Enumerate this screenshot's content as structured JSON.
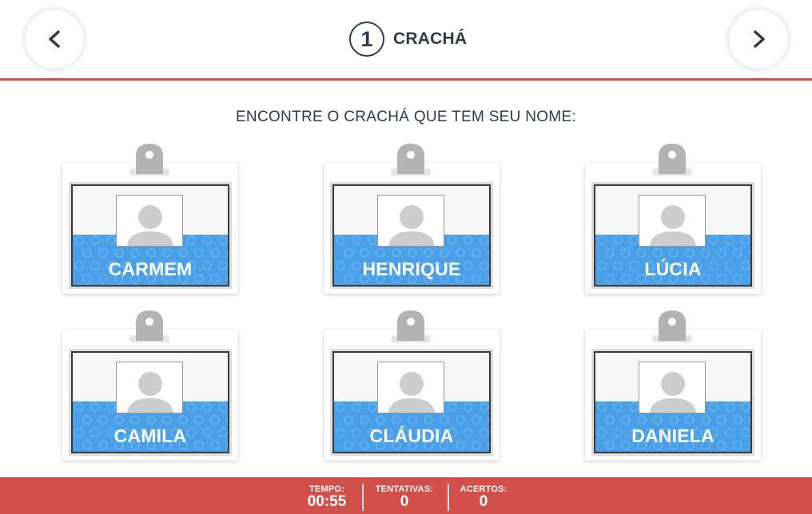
{
  "header": {
    "step_number": "1",
    "title": "CRACHÁ",
    "prev_icon": "chevron-left-icon",
    "next_icon": "chevron-right-icon"
  },
  "instruction": "ENCONTRE O CRACHÁ QUE TEM SEU NOME:",
  "badges": [
    {
      "name": "CARMEM"
    },
    {
      "name": "HENRIQUE"
    },
    {
      "name": "LÚCIA"
    },
    {
      "name": "CAMILA"
    },
    {
      "name": "CLÁUDIA"
    },
    {
      "name": "DANIELA"
    }
  ],
  "footer": {
    "time_label": "TEMPO:",
    "time_value": "00:55",
    "attempts_label": "TENTATIVAS:",
    "attempts_value": "0",
    "hits_label": "ACERTOS:",
    "hits_value": "0"
  },
  "colors": {
    "accent_red": "#d1504b",
    "badge_blue": "#4a9fe6",
    "text_dark": "#2f3a4c"
  }
}
